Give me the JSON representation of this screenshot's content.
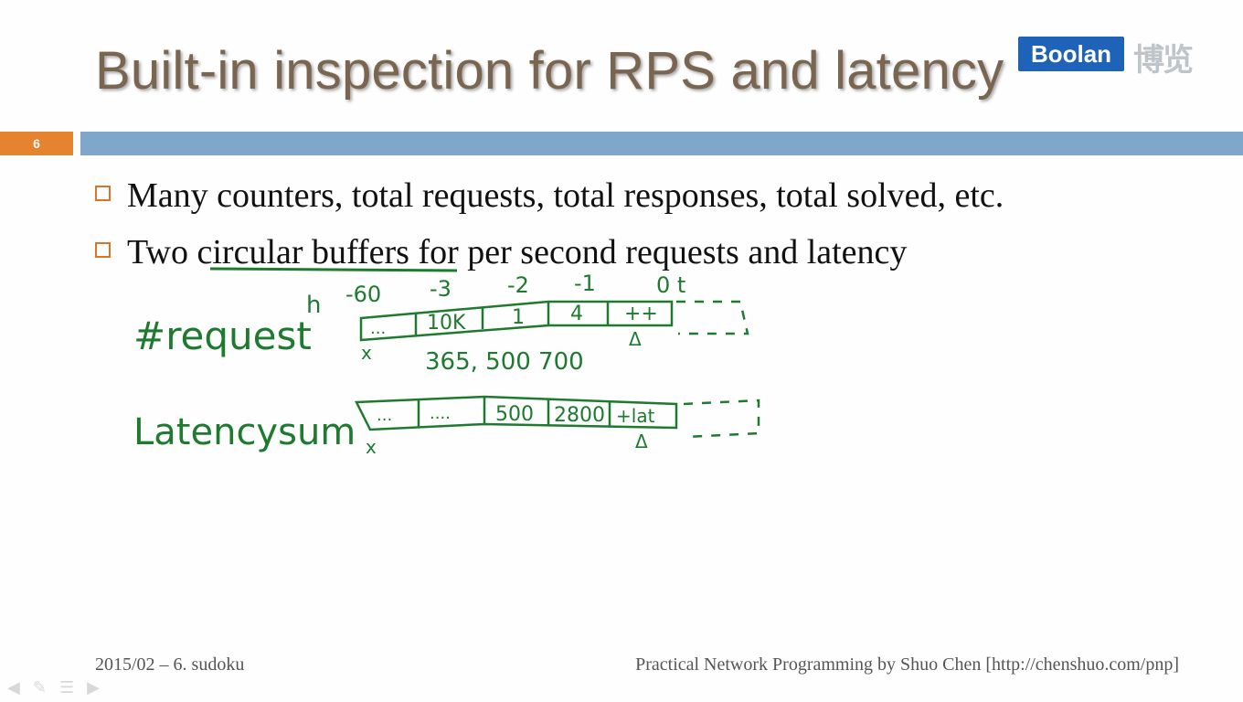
{
  "slide": {
    "title": "Built-in inspection for RPS and latency",
    "page_number": "6",
    "logo_text": "Boolan",
    "logo_cn": "博览",
    "bullets": [
      "Many counters, total requests, total responses, total solved, etc.",
      "Two circular buffers for per second requests and latency"
    ],
    "footer_left": "2015/02 – 6. sudoku",
    "footer_right": "Practical Network Programming by Shuo Chen [http://chenshuo.com/pnp]"
  },
  "handwriting": {
    "label_request": "#request",
    "label_latency": "Latencysum",
    "superscript": "h",
    "time_labels": [
      "-60",
      "-3",
      "-2",
      "-1",
      "0 t"
    ],
    "request_cells": [
      "...",
      "10K",
      "1",
      "4",
      "++"
    ],
    "latency_cells": [
      "...",
      "....",
      "500",
      "2800",
      "+lat"
    ],
    "values_below": "365, 500 700",
    "marker_x": "x",
    "marker_delta": "Δ"
  },
  "colors": {
    "title": "#7a6650",
    "accent_orange": "#e6832f",
    "bar_blue": "#7fa7cc",
    "ink_green": "#1d7a2e",
    "logo_blue": "#1f63b8"
  },
  "icons": [
    "prev-icon",
    "pen-icon",
    "menu-icon",
    "next-icon"
  ]
}
